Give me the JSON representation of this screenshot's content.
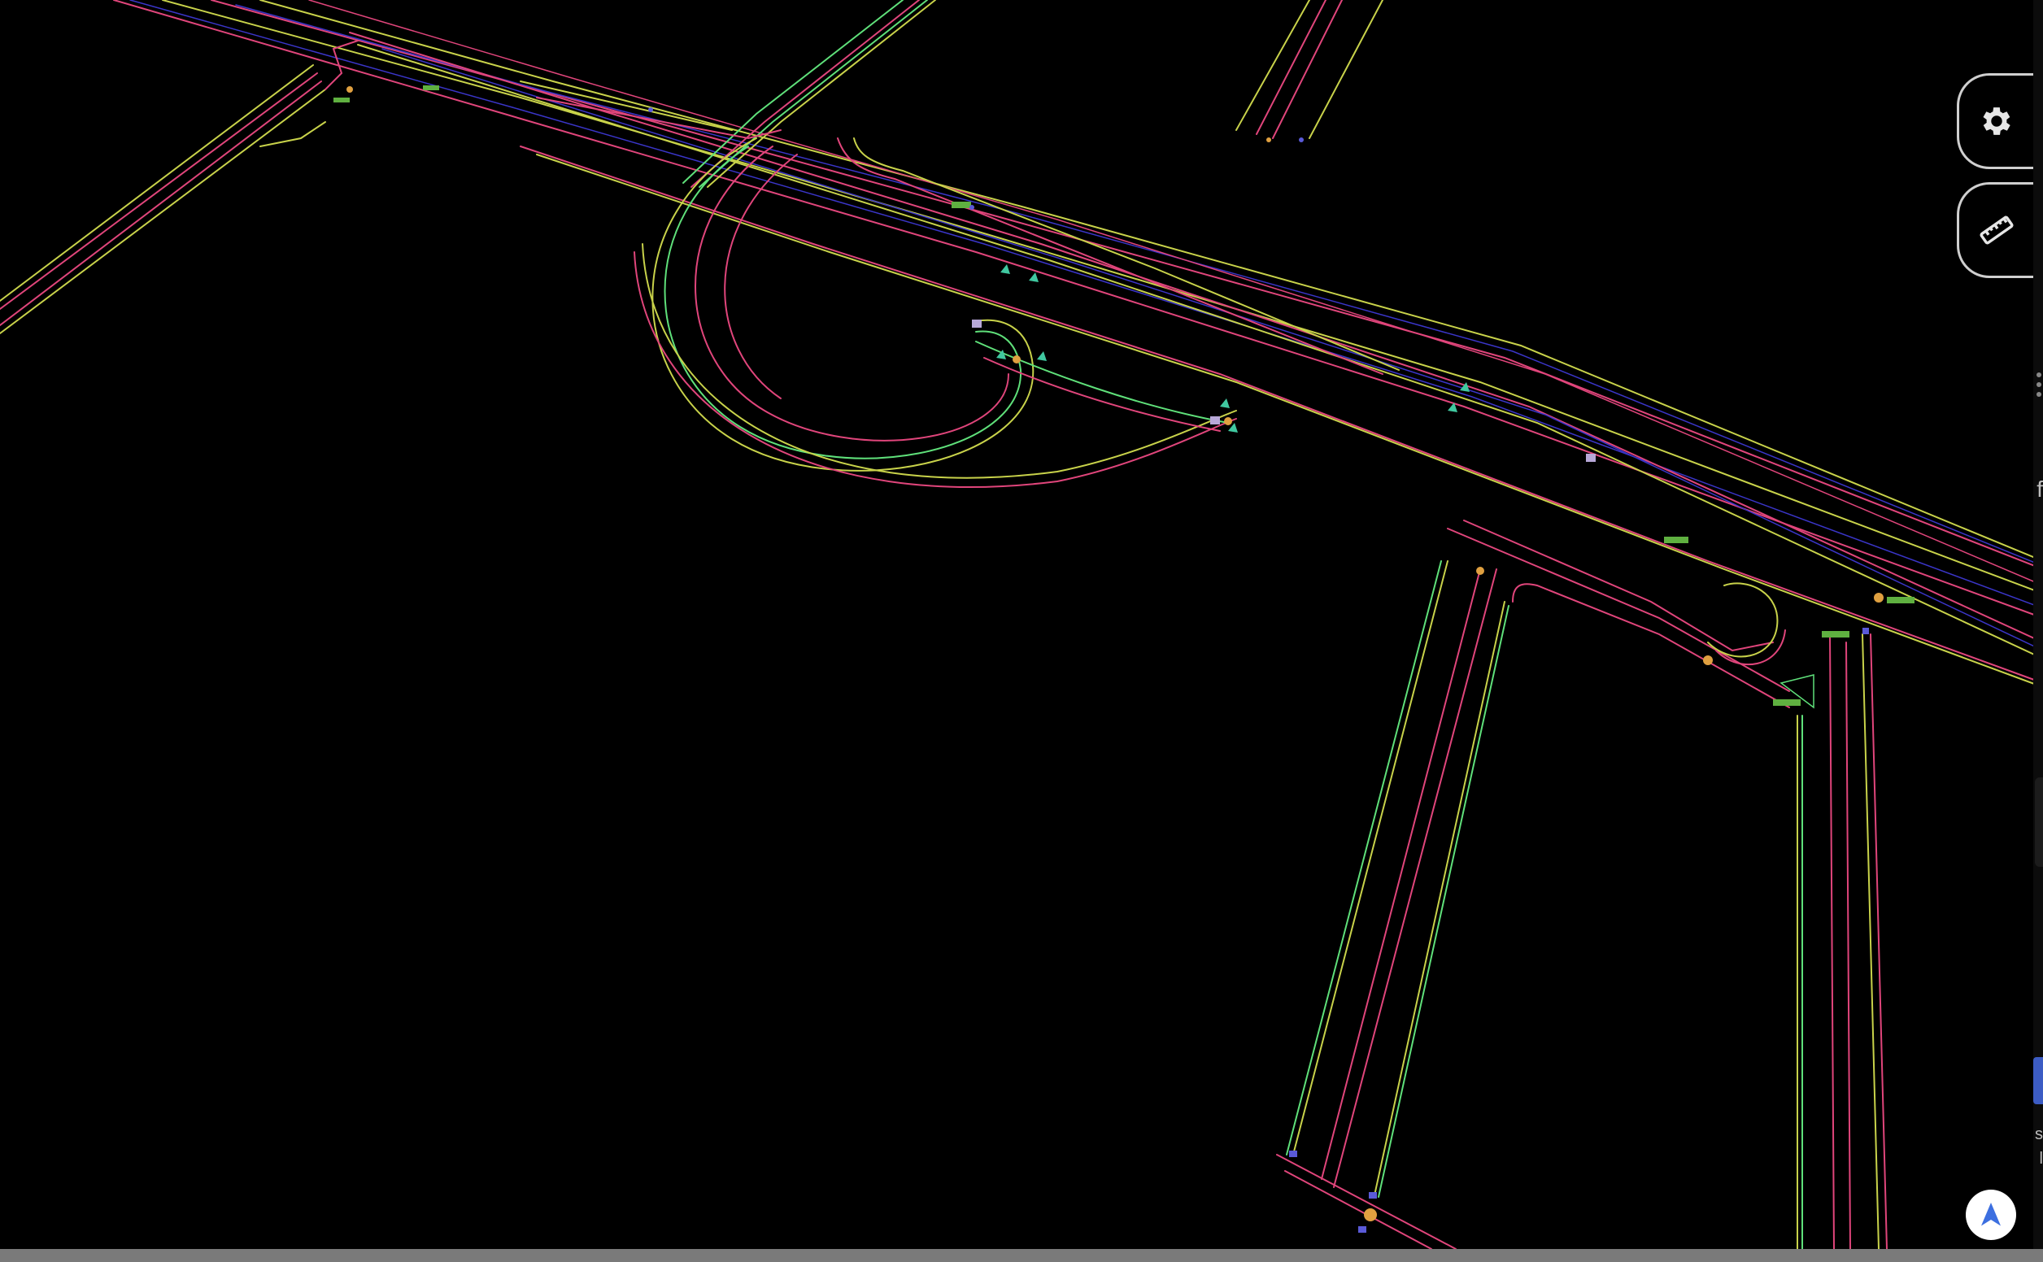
{
  "app": {
    "background_color": "#000000"
  },
  "map": {
    "colors": {
      "lane_boundary_pink": "#e0457b",
      "lane_boundary_yellow": "#c8d24a",
      "lane_boundary_green": "#5fe07a",
      "centerline_blue": "#3a35c8",
      "traffic_sign_teal": "#40c8a0",
      "marker_orange": "#e0a040",
      "stop_line_green": "#5fb040",
      "crosswalk_lilac": "#b8a8d8"
    },
    "features": [
      "highway",
      "cloverleaf-ramp",
      "side-roads",
      "lane-boundaries",
      "traffic-signs"
    ]
  },
  "controls": {
    "settings": {
      "icon": "gear-icon"
    },
    "measure": {
      "icon": "ruler-icon"
    },
    "compass": {
      "icon": "navigation-arrow-icon",
      "accent": "#3c6fe0"
    }
  },
  "right_strip": {
    "glyphs": [
      "f",
      "s",
      "l"
    ]
  }
}
